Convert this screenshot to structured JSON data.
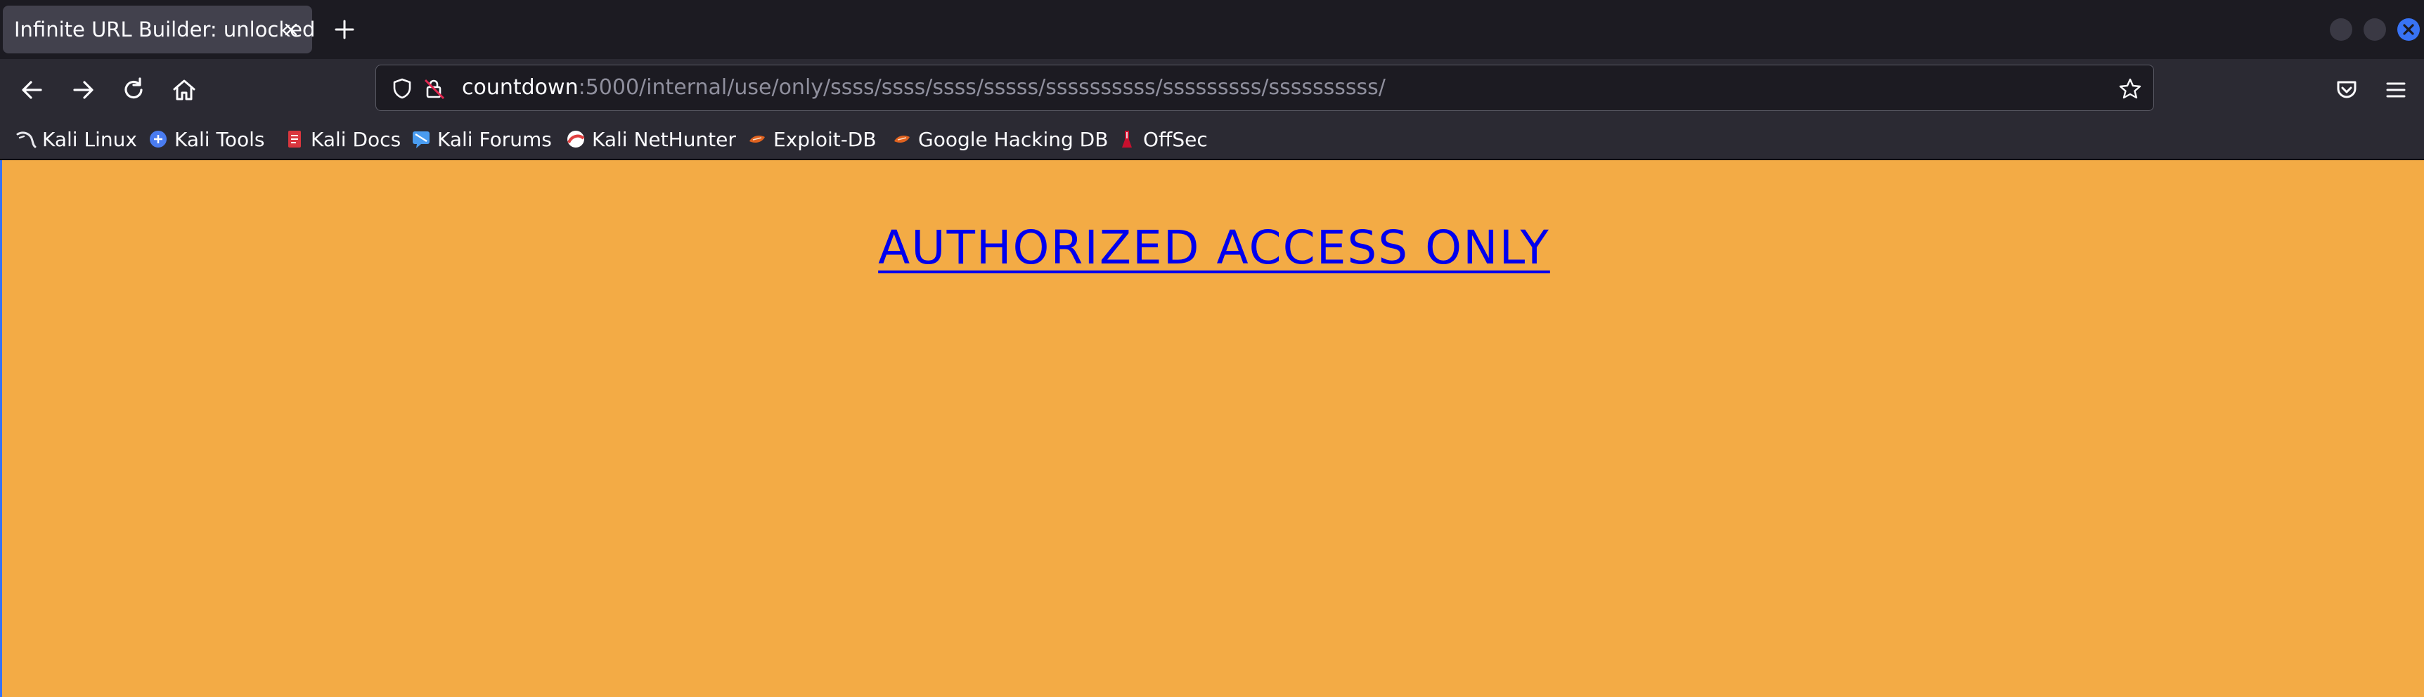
{
  "browser": {
    "tab": {
      "title": "Infinite URL Builder: unlocked",
      "close_glyph": "×"
    },
    "new_tab_glyph": "+",
    "address": {
      "host": "countdown",
      "rest": ":5000/internal/use/only/ssss/ssss/ssss/sssss/ssssssssss/sssssssss/ssssssssss/"
    },
    "bookmarks": [
      {
        "label": "Kali Linux",
        "icon": "kali-dragon-icon",
        "color": "#e8e8ee"
      },
      {
        "label": "Kali Tools",
        "icon": "kali-tools-icon",
        "color": "#4a7cf0"
      },
      {
        "label": "Kali Docs",
        "icon": "kali-docs-icon",
        "color": "#d9363e"
      },
      {
        "label": "Kali Forums",
        "icon": "kali-forums-icon",
        "color": "#4a9cf0"
      },
      {
        "label": "Kali NetHunter",
        "icon": "kali-nethunter-icon",
        "color": "#e04040"
      },
      {
        "label": "Exploit-DB",
        "icon": "exploit-db-icon",
        "color": "#e0621f"
      },
      {
        "label": "Google Hacking DB",
        "icon": "ghdb-icon",
        "color": "#e0621f"
      },
      {
        "label": "OffSec",
        "icon": "offsec-icon",
        "color": "#c8102e"
      }
    ]
  },
  "page": {
    "heading": "AUTHORIZED ACCESS ONLY",
    "background": "#f3ab45",
    "link_color": "#0000ee"
  }
}
